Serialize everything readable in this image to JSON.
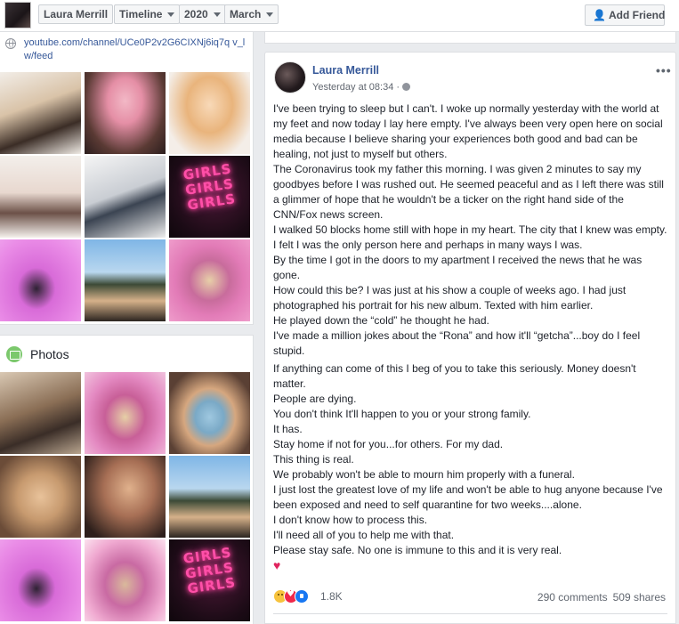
{
  "header": {
    "profile_name": "Laura Merrill",
    "timeline_label": "Timeline",
    "year_label": "2020",
    "month_label": "March",
    "add_friend_label": "Add Friend"
  },
  "intro": {
    "channel_link": "youtube.com/channel/UCe0P2v2G6CIXNj6iq7q v_lw/feed"
  },
  "intro_grid": [
    {
      "neon": ""
    },
    {
      "neon": ""
    },
    {
      "neon": ""
    },
    {
      "neon": ""
    },
    {
      "neon": ""
    },
    {
      "neon": "GIRLS GIRLS GIRLS"
    },
    {
      "neon": ""
    },
    {
      "neon": ""
    },
    {
      "neon": ""
    }
  ],
  "photos": {
    "title": "Photos",
    "grid": [
      {
        "neon": ""
      },
      {
        "neon": ""
      },
      {
        "neon": ""
      },
      {
        "neon": ""
      },
      {
        "neon": ""
      },
      {
        "neon": ""
      },
      {
        "neon": ""
      },
      {
        "neon": ""
      },
      {
        "neon": "GIRLS GIRLS GIRLS"
      }
    ]
  },
  "post": {
    "author": "Laura Merrill",
    "time": "Yesterday at 08:34 ·",
    "more": "•••",
    "paragraphs": [
      "I've been trying to sleep but I can't. I woke up normally yesterday with the world at my feet and now today I lay here empty. I've always been very open here on social media because I believe sharing your experiences both good and bad can be healing, not just to myself but others.",
      "The Coronavirus took my father this morning. I was given 2 minutes to say my goodbyes before I was rushed out. He seemed peaceful and as I left there was still a glimmer of hope that he wouldn't be a ticker on the right hand side of the CNN/Fox news screen.",
      "I walked 50 blocks home still with hope in my heart. The city that I knew was empty. I felt I was the only person here and perhaps in many ways I was.",
      "By the time I got in the doors to my apartment I received the news that he was gone.",
      "How could this be? I was just at his show a couple of weeks ago. I had just photographed his portrait for his new album. Texted with him earlier.",
      "He played down the “cold” he thought he had.",
      "I've made a million jokes about the “Rona” and how it'll “getcha”...boy do I feel stupid."
    ],
    "paragraphs2": [
      "If anything can come of this I beg of you to take this seriously. Money doesn't matter.",
      "People are dying.",
      "You don't think It'll happen to you or your strong family.",
      "It has.",
      "Stay home if not for you...for others. For my dad.",
      "This thing is real.",
      "We probably won't be able to mourn him properly with a funeral.",
      "I just lost the greatest love of my life and won't be able to hug anyone because I've been exposed and need to self quarantine for two weeks....alone.",
      "I don't know how to process this.",
      "I'll need all of you to help me with that.",
      "Please stay safe. No one is immune to this and it is very real."
    ],
    "heart": "♥",
    "reaction_count": "1.8K",
    "comments": "290 comments",
    "shares": "509 shares"
  },
  "colors": {
    "link": "#365899",
    "page_bg": "#e9ebee",
    "heart": "#e0245e"
  }
}
